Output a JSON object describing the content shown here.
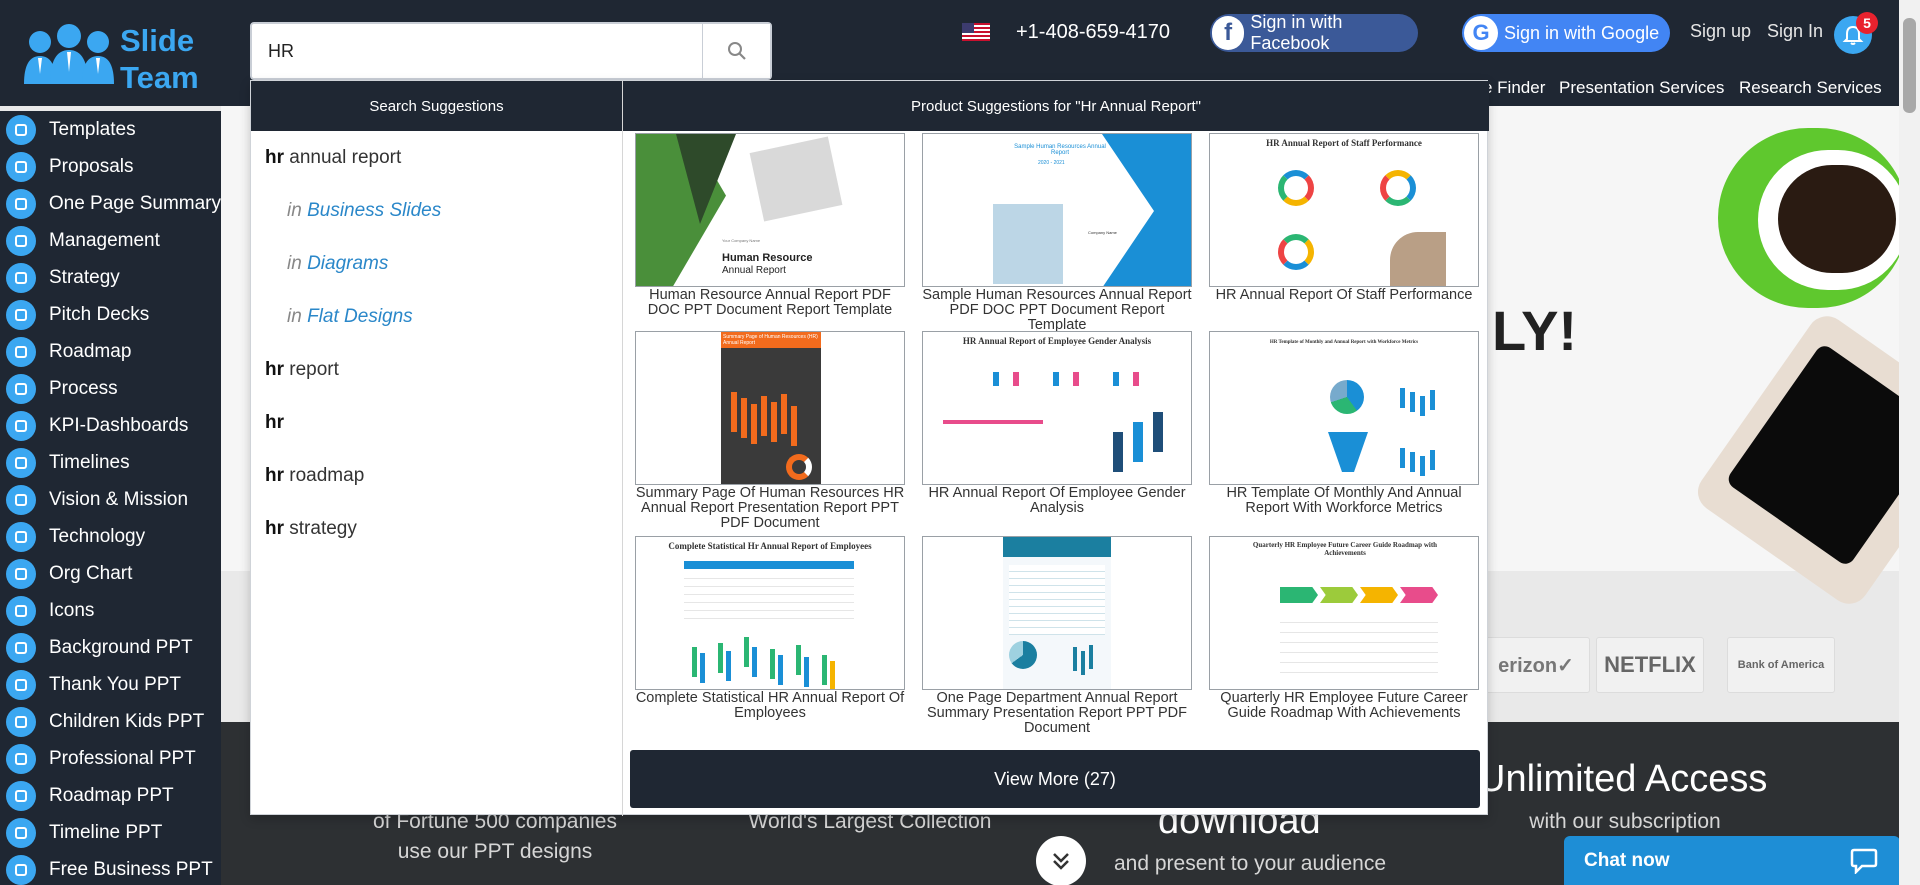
{
  "header": {
    "logo_line1": "Slide",
    "logo_line2": "Team",
    "phone": "+1-408-659-4170",
    "facebook_label": "Sign in with Facebook",
    "google_label": "Sign in with Google",
    "signup_label": "Sign up",
    "signin_label": "Sign In",
    "notification_count": "5",
    "nav_items": [
      "e Finder",
      "Presentation Services",
      "Research Services"
    ]
  },
  "search": {
    "value": "HR"
  },
  "dropdown": {
    "left_heading": "Search Suggestions",
    "right_heading": "Product Suggestions for \"Hr Annual Report\"",
    "suggestions": [
      {
        "bold": "hr",
        "rest": " annual report"
      },
      {
        "bold": "hr",
        "rest": " report"
      },
      {
        "bold": "hr",
        "rest": ""
      },
      {
        "bold": "hr",
        "rest": " roadmap"
      },
      {
        "bold": "hr",
        "rest": " strategy"
      }
    ],
    "sub_prefix": "in",
    "sub_suggestions": [
      "Business Slides",
      "Diagrams",
      "Flat Designs"
    ],
    "products": [
      {
        "caption": "Human Resource Annual Report PDF DOC PPT Document Report Template",
        "thumb_text_1": "Human Resource",
        "thumb_text_2": "Annual Report",
        "thumb_text_3": "Your Company Name"
      },
      {
        "caption": "Sample Human Resources Annual Report PDF DOC PPT Document Report Template",
        "thumb_text_1": "Sample Human Resources Annual Report",
        "thumb_text_2": "2020 - 2021",
        "thumb_text_3": "Company Name"
      },
      {
        "caption": "HR Annual Report Of Staff Performance",
        "thumb_text_1": "HR Annual Report of Staff Performance"
      },
      {
        "caption": "Summary Page Of Human Resources HR Annual Report Presentation Report PPT PDF Document",
        "thumb_text_1": "Summary Page of Human Resources (HR) Annual Report"
      },
      {
        "caption": "HR Annual Report Of Employee Gender Analysis",
        "thumb_text_1": "HR Annual Report of Employee Gender Analysis"
      },
      {
        "caption": "HR Template Of Monthly And Annual Report With Workforce Metrics",
        "thumb_text_1": "HR Template of Monthly and Annual Report with Workforce Metrics"
      },
      {
        "caption": "Complete Statistical HR Annual Report Of Employees",
        "thumb_text_1": "Complete Statistical Hr Annual Report of Employees"
      },
      {
        "caption": "One Page Department Annual Report Summary Presentation Report PPT PDF Document",
        "thumb_text_1": ""
      },
      {
        "caption": "Quarterly HR Employee Future Career Guide Roadmap With Achievements",
        "thumb_text_1": "Quarterly HR Employee Future Career Guide Roadmap with Achievements"
      }
    ],
    "view_more_label": "View More (27)"
  },
  "sidebar": {
    "items": [
      "Templates",
      "Proposals",
      "One Page Summary",
      "Management",
      "Strategy",
      "Pitch Decks",
      "Roadmap",
      "Process",
      "KPI-Dashboards",
      "Timelines",
      "Vision & Mission",
      "Technology",
      "Org Chart",
      "Icons",
      "Background PPT",
      "Thank You PPT",
      "Children Kids PPT",
      "Professional PPT",
      "Roadmap PPT",
      "Timeline PPT",
      "Free Business PPT"
    ]
  },
  "background": {
    "hero_partial": "LY!",
    "brands": [
      "erizon✓",
      "NETFLIX",
      "Bank of America"
    ],
    "band": {
      "col1_line1": "of Fortune 500 companies",
      "col1_line2": "use our PPT designs",
      "col2_line1": "World's Largest Collection",
      "col3_big": "download",
      "col3_line2": "and present to your audience",
      "col4_big": "Unlimited Access",
      "col4_line2": "with our subscription"
    }
  },
  "chat": {
    "label": "Chat now"
  },
  "colors": {
    "header_bg": "#1f2733",
    "accent_blue": "#3ba7f1",
    "facebook": "#3b5998",
    "google": "#4285f4",
    "badge_red": "#e8222e",
    "link_blue": "#2a87c9"
  },
  "icons": [
    "search-icon",
    "flag-us-icon",
    "facebook-icon",
    "google-icon",
    "bell-icon",
    "chevron-double-down-icon",
    "chat-bubble-icon"
  ]
}
